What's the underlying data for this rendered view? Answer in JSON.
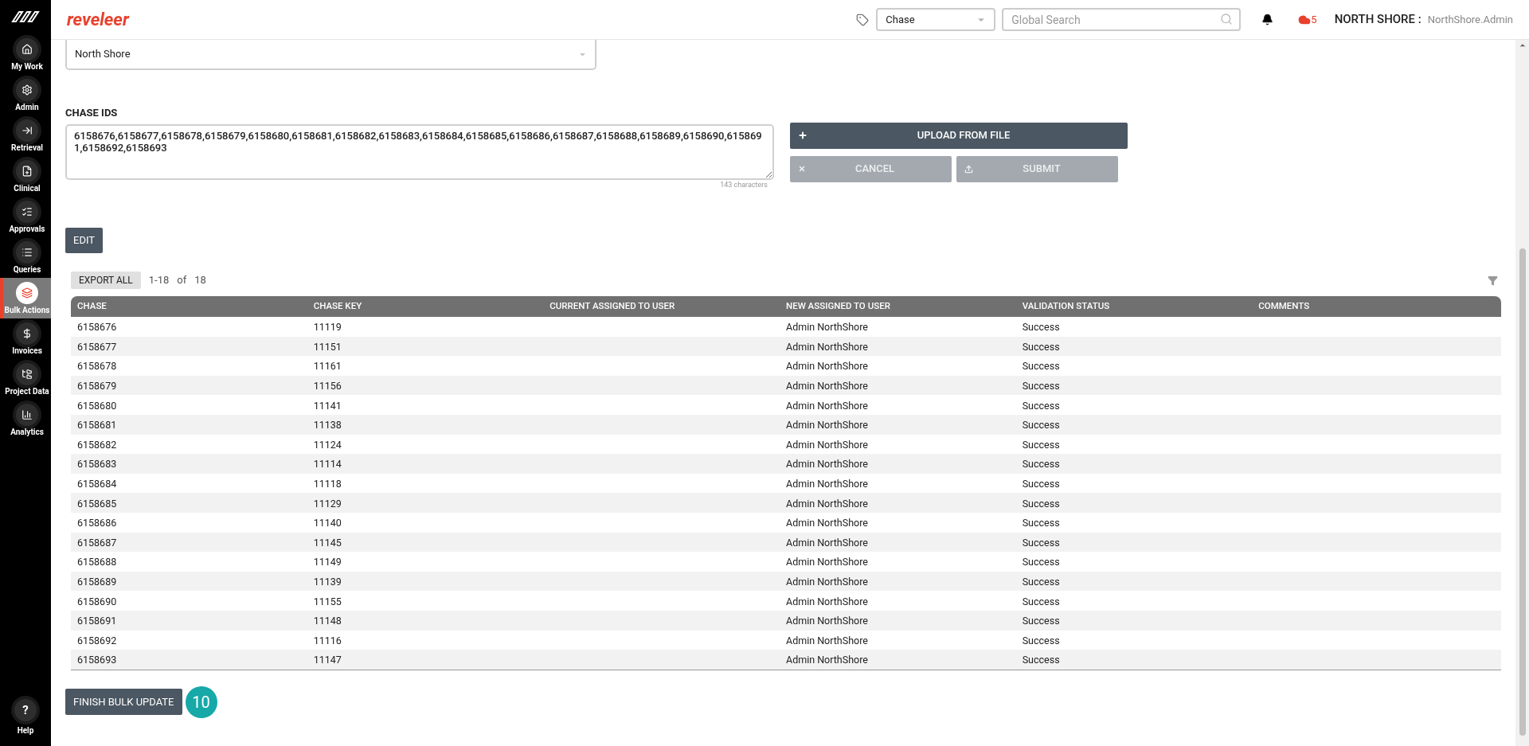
{
  "sidebar": {
    "items": [
      {
        "label": "My Work",
        "selected": false
      },
      {
        "label": "Admin",
        "selected": false
      },
      {
        "label": "Retrieval",
        "selected": false
      },
      {
        "label": "Clinical",
        "selected": false
      },
      {
        "label": "Approvals",
        "selected": false
      },
      {
        "label": "Queries",
        "selected": false
      },
      {
        "label": "Bulk Actions",
        "selected": true
      },
      {
        "label": "Invoices",
        "selected": false
      },
      {
        "label": "Project Data",
        "selected": false
      },
      {
        "label": "Analytics",
        "selected": false
      }
    ],
    "help": {
      "label": "Help",
      "glyph": "?"
    }
  },
  "header": {
    "logo": "reveleer",
    "search_type": "Chase",
    "search": {
      "placeholder": "Global Search"
    },
    "alert_count": "5",
    "org": "NORTH SHORE :",
    "user": "NorthShore.Admin"
  },
  "project_select": {
    "value": "North Shore"
  },
  "chase_ids": {
    "label": "CHASE IDS",
    "value": "6158676,6158677,6158678,6158679,6158680,6158681,6158682,6158683,6158684,6158685,6158686,6158687,6158688,6158689,6158690,6158691,6158692,6158693",
    "count": "143 characters"
  },
  "actions": {
    "upload": {
      "label": "UPLOAD FROM FILE",
      "disabled": false
    },
    "cancel": {
      "label": "CANCEL",
      "disabled": true
    },
    "submit": {
      "label": "SUBMIT",
      "disabled": true
    }
  },
  "edit_button": "EDIT",
  "table": {
    "export": "EXPORT ALL",
    "range": "1-18",
    "of": "of",
    "total": "18",
    "columns": [
      "CHASE",
      "CHASE KEY",
      "CURRENT ASSIGNED TO USER",
      "NEW ASSIGNED TO USER",
      "VALIDATION STATUS",
      "COMMENTS"
    ],
    "rows": [
      [
        "6158676",
        "11119",
        "",
        "Admin NorthShore",
        "Success",
        ""
      ],
      [
        "6158677",
        "11151",
        "",
        "Admin NorthShore",
        "Success",
        ""
      ],
      [
        "6158678",
        "11161",
        "",
        "Admin NorthShore",
        "Success",
        ""
      ],
      [
        "6158679",
        "11156",
        "",
        "Admin NorthShore",
        "Success",
        ""
      ],
      [
        "6158680",
        "11141",
        "",
        "Admin NorthShore",
        "Success",
        ""
      ],
      [
        "6158681",
        "11138",
        "",
        "Admin NorthShore",
        "Success",
        ""
      ],
      [
        "6158682",
        "11124",
        "",
        "Admin NorthShore",
        "Success",
        ""
      ],
      [
        "6158683",
        "11114",
        "",
        "Admin NorthShore",
        "Success",
        ""
      ],
      [
        "6158684",
        "11118",
        "",
        "Admin NorthShore",
        "Success",
        ""
      ],
      [
        "6158685",
        "11129",
        "",
        "Admin NorthShore",
        "Success",
        ""
      ],
      [
        "6158686",
        "11140",
        "",
        "Admin NorthShore",
        "Success",
        ""
      ],
      [
        "6158687",
        "11145",
        "",
        "Admin NorthShore",
        "Success",
        ""
      ],
      [
        "6158688",
        "11149",
        "",
        "Admin NorthShore",
        "Success",
        ""
      ],
      [
        "6158689",
        "11139",
        "",
        "Admin NorthShore",
        "Success",
        ""
      ],
      [
        "6158690",
        "11155",
        "",
        "Admin NorthShore",
        "Success",
        ""
      ],
      [
        "6158691",
        "11148",
        "",
        "Admin NorthShore",
        "Success",
        ""
      ],
      [
        "6158692",
        "11116",
        "",
        "Admin NorthShore",
        "Success",
        ""
      ],
      [
        "6158693",
        "11147",
        "",
        "Admin NorthShore",
        "Success",
        ""
      ]
    ]
  },
  "finish": {
    "label": "FINISH BULK UPDATE",
    "step": "10"
  }
}
